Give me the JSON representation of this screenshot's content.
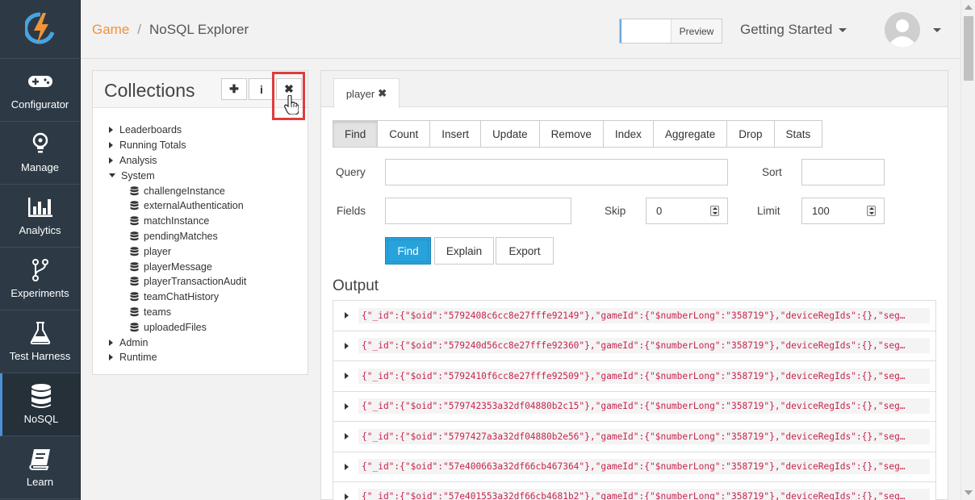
{
  "sidebar": {
    "items": [
      {
        "label": "Configurator",
        "icon": "gamepad-icon"
      },
      {
        "label": "Manage",
        "icon": "lightbulb-icon"
      },
      {
        "label": "Analytics",
        "icon": "bar-chart-icon"
      },
      {
        "label": "Experiments",
        "icon": "branch-icon"
      },
      {
        "label": "Test Harness",
        "icon": "flask-icon"
      },
      {
        "label": "NoSQL",
        "icon": "database-icon"
      },
      {
        "label": "Learn",
        "icon": "book-icon"
      }
    ],
    "active": "NoSQL"
  },
  "header": {
    "breadcrumb_link": "Game",
    "breadcrumb_sep": "/",
    "breadcrumb_current": "NoSQL Explorer",
    "preview_label": "Preview",
    "getting_started_label": "Getting Started"
  },
  "collections": {
    "title": "Collections",
    "add_btn": "✚",
    "info_btn": "i",
    "close_btn": "✖",
    "groups": [
      {
        "label": "Leaderboards",
        "expanded": false
      },
      {
        "label": "Running Totals",
        "expanded": false
      },
      {
        "label": "Analysis",
        "expanded": false
      },
      {
        "label": "System",
        "expanded": true
      },
      {
        "label": "Admin",
        "expanded": false
      },
      {
        "label": "Runtime",
        "expanded": false
      }
    ],
    "system_items": [
      "challengeInstance",
      "externalAuthentication",
      "matchInstance",
      "pendingMatches",
      "player",
      "playerMessage",
      "playerTransactionAudit",
      "teamChatHistory",
      "teams",
      "uploadedFiles"
    ]
  },
  "editor": {
    "tab_label": "player",
    "tab_close": "✖",
    "operations": [
      "Find",
      "Count",
      "Insert",
      "Update",
      "Remove",
      "Index",
      "Aggregate",
      "Drop",
      "Stats"
    ],
    "active_operation": "Find",
    "form": {
      "query_label": "Query",
      "query_value": "",
      "sort_label": "Sort",
      "sort_value": "",
      "fields_label": "Fields",
      "fields_value": "",
      "skip_label": "Skip",
      "skip_value": "0",
      "limit_label": "Limit",
      "limit_value": "100"
    },
    "actions": {
      "find": "Find",
      "explain": "Explain",
      "export": "Export"
    },
    "output_title": "Output",
    "output_rows": [
      "{\"_id\":{\"$oid\":\"5792408c6cc8e27fffe92149\"},\"gameId\":{\"$numberLong\":\"358719\"},\"deviceRegIds\":{},\"seg…",
      "{\"_id\":{\"$oid\":\"579240d56cc8e27fffe92360\"},\"gameId\":{\"$numberLong\":\"358719\"},\"deviceRegIds\":{},\"seg…",
      "{\"_id\":{\"$oid\":\"5792410f6cc8e27fffe92509\"},\"gameId\":{\"$numberLong\":\"358719\"},\"deviceRegIds\":{},\"seg…",
      "{\"_id\":{\"$oid\":\"579742353a32df04880b2c15\"},\"gameId\":{\"$numberLong\":\"358719\"},\"deviceRegIds\":{},\"seg…",
      "{\"_id\":{\"$oid\":\"5797427a3a32df04880b2e56\"},\"gameId\":{\"$numberLong\":\"358719\"},\"deviceRegIds\":{},\"seg…",
      "{\"_id\":{\"$oid\":\"57e400663a32df66cb467364\"},\"gameId\":{\"$numberLong\":\"358719\"},\"deviceRegIds\":{},\"seg…",
      "{\"_id\":{\"$oid\":\"57e401553a32df66cb4681b2\"},\"gameId\":{\"$numberLong\":\"358719\"},\"deviceRegIds\":{},\"seg…"
    ]
  },
  "colors": {
    "sidebar_bg": "#2d3a46",
    "accent_orange": "#f0933a",
    "primary_blue": "#27a2db",
    "highlight_red": "#e03c3c",
    "code_red": "#c7254e"
  }
}
